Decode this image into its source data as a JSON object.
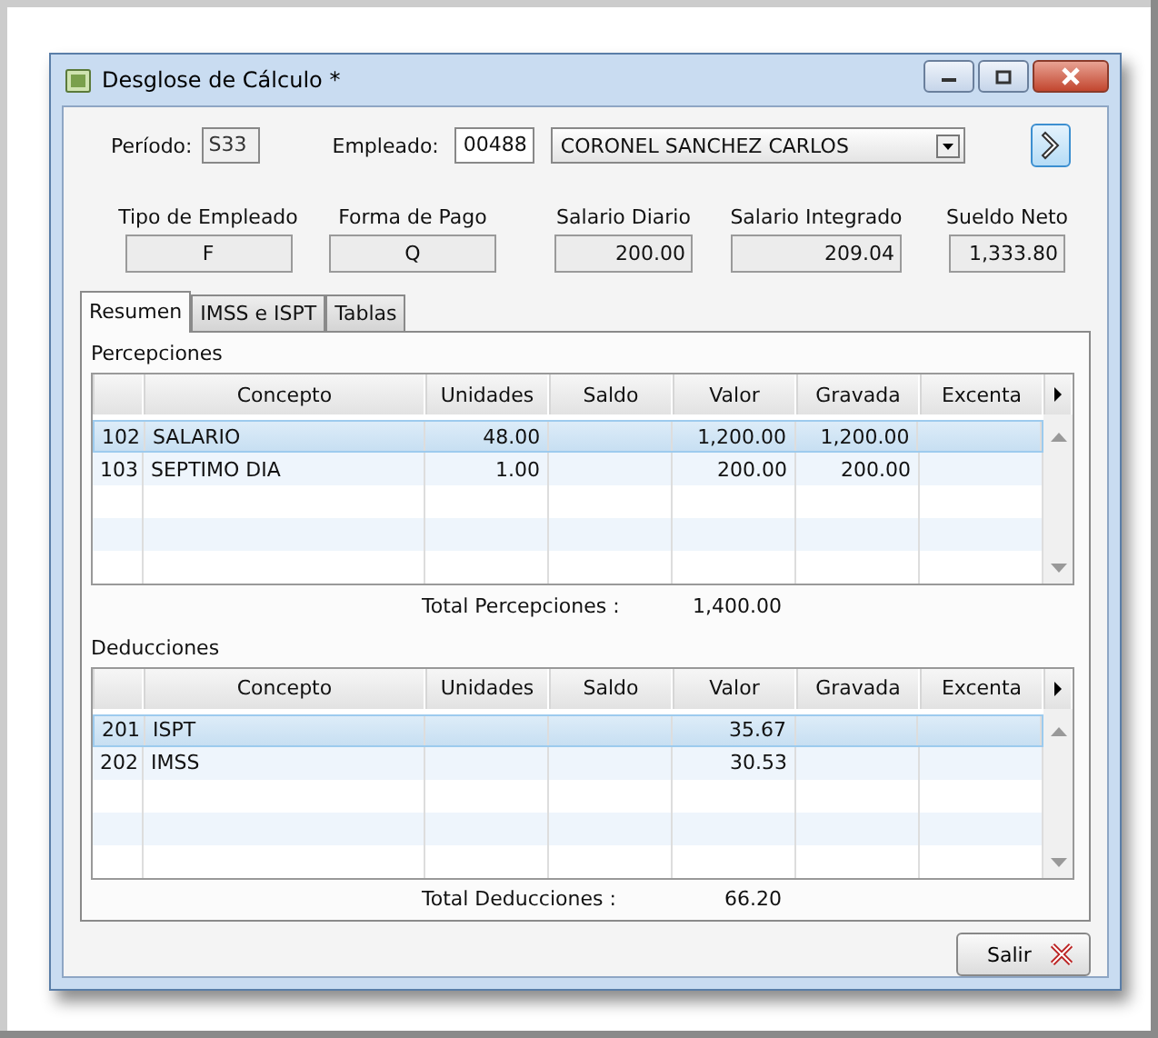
{
  "window": {
    "title": "Desglose de Cálculo *"
  },
  "period": {
    "label": "Período:",
    "value": "S33"
  },
  "employee": {
    "label": "Empleado:",
    "code": "00488",
    "name": "CORONEL SANCHEZ CARLOS"
  },
  "summary": [
    {
      "label": "Tipo de Empleado",
      "value": "F",
      "kind": "code"
    },
    {
      "label": "Forma de Pago",
      "value": "Q",
      "kind": "code"
    },
    {
      "label": "Salario Diario",
      "value": "200.00",
      "kind": "amount"
    },
    {
      "label": "Salario Integrado",
      "value": "209.04",
      "kind": "amount"
    },
    {
      "label": "Sueldo Neto",
      "value": "1,333.80",
      "kind": "amount"
    }
  ],
  "tabs": [
    {
      "label": "Resumen",
      "selected": true
    },
    {
      "label": "IMSS e ISPT",
      "selected": false
    },
    {
      "label": "Tablas",
      "selected": false
    }
  ],
  "sections": [
    {
      "title": "Percepciones",
      "columns": [
        "Concepto",
        "Unidades",
        "Saldo",
        "Valor",
        "Gravada",
        "Excenta"
      ],
      "rows": [
        {
          "code": "102",
          "concept": "SALARIO",
          "units": "48.00",
          "value": "1,200.00",
          "taxed": "1,200.00",
          "selected": true
        },
        {
          "code": "103",
          "concept": "SEPTIMO DIA",
          "units": "1.00",
          "value": "200.00",
          "taxed": "200.00",
          "selected": false
        }
      ],
      "total_label": "Total Percepciones :",
      "total_value": "1,400.00"
    },
    {
      "title": "Deducciones",
      "columns": [
        "Concepto",
        "Unidades",
        "Saldo",
        "Valor",
        "Gravada",
        "Excenta"
      ],
      "rows": [
        {
          "code": "201",
          "concept": "ISPT",
          "value": "35.67",
          "selected": true
        },
        {
          "code": "202",
          "concept": "IMSS",
          "value": "30.53",
          "selected": false
        }
      ],
      "total_label": "Total Deducciones :",
      "total_value": "66.20"
    }
  ],
  "exit_button": {
    "label": "Salir"
  }
}
